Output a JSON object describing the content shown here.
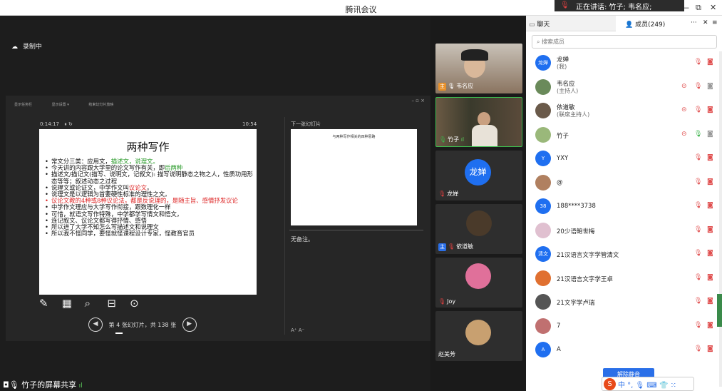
{
  "app": {
    "title": "腾讯会议"
  },
  "speaking": {
    "text": "正在讲话: 竹子; 韦名应;"
  },
  "window": {
    "min": "—",
    "restore": "⧉",
    "close": "✕"
  },
  "recording": {
    "label": "录制中"
  },
  "ppt": {
    "toolbar": [
      "显示任务栏",
      "显示设置 ▾",
      "结束幻灯片放映"
    ],
    "window_ctrls": "–  ▫  ×",
    "elapsed": "0:14:17",
    "pause_icon": "⏸ ↻",
    "clock": "10:54",
    "slide": {
      "title": "两种写作",
      "bullets": [
        {
          "parts": [
            {
              "t": "常文分三类：应用文，"
            },
            {
              "t": "描述文，说理文。",
              "c": "green"
            }
          ]
        },
        {
          "parts": [
            {
              "t": "今天讲的内容跟大学里的论文写作有关，即"
            },
            {
              "t": "后两种",
              "c": "green"
            }
          ]
        },
        {
          "parts": [
            {
              "t": "描述文/描记文(描写、说明文，记叙文): 描写说明静态之物之人，性质功用形态等等；叙述动态之过程"
            }
          ]
        },
        {
          "parts": [
            {
              "t": "说理文或论证文，中学作文叫"
            },
            {
              "t": "议论文",
              "c": "red"
            },
            {
              "t": "。"
            }
          ]
        },
        {
          "parts": [
            {
              "t": "说理文是以逻辑为首要硬性标准的理性之文。"
            }
          ]
        },
        {
          "red": true,
          "parts": [
            {
              "t": "议论文",
              "c": "red"
            },
            {
              "t": "教的4种或8种议论法，都是反说理的，是随主旨、感情抒发议论"
            }
          ]
        },
        {
          "parts": [
            {
              "t": "中学作文理应与大学写作衔接，跟数理化一样"
            }
          ]
        },
        {
          "parts": [
            {
              "t": "可惜，就语文写作特殊，中学都学写情文和悟文，"
            }
          ]
        },
        {
          "parts": [
            {
              "t": "连记叙文、议论文都写得抒情、感悟"
            }
          ]
        },
        {
          "parts": [
            {
              "t": "所以进了大学不知怎么写描述文和说理文"
            }
          ]
        },
        {
          "parts": [
            {
              "t": "所以我不怪同学，要怪就怪课程设计专家，怪教育官员"
            }
          ]
        }
      ]
    },
    "next_label": "下一张幻灯片",
    "next_slide_title": "与两种写作相关的四种思路",
    "notes": "无备注。",
    "notes_tools": "A⁺  A⁻",
    "slide_counter": "第 4 张幻灯片，共 138 张"
  },
  "share": {
    "label": "竹子的屏幕共享",
    "signal": "ıl",
    "icon": "◘🎙"
  },
  "videos": [
    {
      "name": "韦名应",
      "host": true,
      "mic": "on"
    },
    {
      "name": "竹子",
      "mic": "on",
      "signal": "ıl"
    },
    {
      "name": "龙婵",
      "avatar": "龙婵",
      "mic": "off"
    },
    {
      "name": "依道敏",
      "host": true,
      "mic": "off"
    },
    {
      "name": "Joy",
      "mic": "off"
    },
    {
      "name": "赵美芳"
    }
  ],
  "sidebar": {
    "tab_chat": "聊天",
    "tab_members": "成员(249)",
    "tab_more": "···",
    "tab_close": "✕",
    "menu": "≡",
    "search_placeholder": "搜索成员",
    "members": [
      {
        "name": "龙婵",
        "role": "(我)",
        "avatar": "龙婵",
        "color": "#1f6ff0"
      },
      {
        "name": "韦名应",
        "role": "(主持人)",
        "color": "#6a8a5a"
      },
      {
        "name": "依道敏",
        "role": "(联席主持人)",
        "color": "#6a5a4a"
      },
      {
        "name": "竹子",
        "role": "",
        "color": "#9ab87a"
      },
      {
        "name": "YXY",
        "role": "",
        "avatar": "Y",
        "color": "#1f6ff0"
      },
      {
        "name": "@",
        "role": "",
        "color": "#b08060"
      },
      {
        "name": "188****3738",
        "role": "",
        "avatar": "38",
        "color": "#1f6ff0"
      },
      {
        "name": "20少语鲍世梅",
        "role": "",
        "color": "#e0c0d0"
      },
      {
        "name": "21汉语言文字学管清文",
        "role": "",
        "avatar": "清文",
        "color": "#1f6ff0"
      },
      {
        "name": "21汉语言文字学王卓",
        "role": "",
        "color": "#e07030"
      },
      {
        "name": "21文字学卢瑞",
        "role": "",
        "color": "#555555"
      },
      {
        "name": "7",
        "role": "",
        "color": "#c07070"
      },
      {
        "name": "A",
        "role": "",
        "avatar": "A",
        "color": "#1f6ff0"
      }
    ],
    "unmute": "解除静音",
    "ime": "中 °, 🎙 ⌨ 👕 ⁙",
    "ime_logo": "S"
  }
}
